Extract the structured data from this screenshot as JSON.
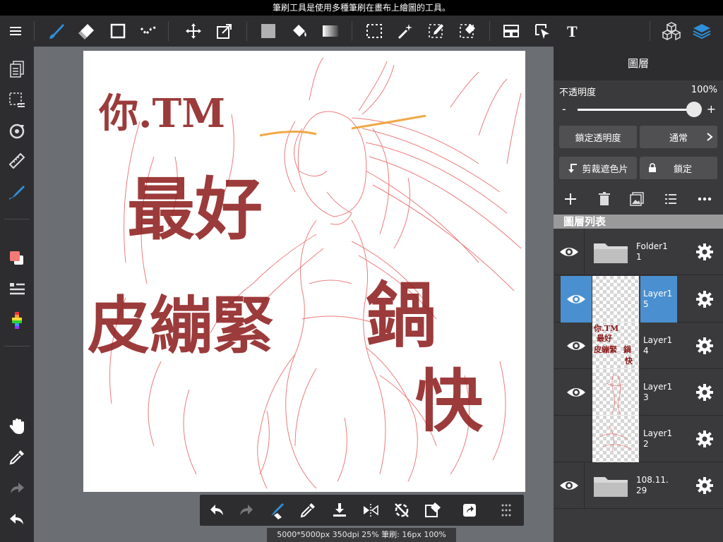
{
  "message": "筆刷工具是使用多種筆刷在畫布上繪圖的工具。",
  "status": "5000*5000px 350dpi 25% 筆刷: 16px 100%",
  "colors": {
    "accent": "#2f8fd8",
    "bg": "#6b6e73",
    "bar": "#2d2d2f",
    "panel": "#3a3a3c",
    "primary_color": "#f47a78",
    "selected_layer": "#4a90d0"
  },
  "panel": {
    "title": "圖層",
    "opacity_label": "不透明度",
    "opacity_value": "100%",
    "opacity_fraction": 1.0,
    "minus": "-",
    "plus": "+",
    "lock_opacity": "鎖定透明度",
    "blend_mode": "通常",
    "clipping": "剪裁遮色片",
    "lock": "鎖定",
    "list_header": "圖層列表"
  },
  "layers": [
    {
      "name": "Folder11",
      "type": "folder",
      "visible": true,
      "selected": false
    },
    {
      "name": "Layer15",
      "type": "layer",
      "visible": true,
      "selected": true
    },
    {
      "name": "Layer14",
      "type": "layer",
      "visible": true,
      "selected": false
    },
    {
      "name": "Layer13",
      "type": "layer",
      "visible": true,
      "selected": false
    },
    {
      "name": "Layer12",
      "type": "layer",
      "visible": false,
      "selected": false
    },
    {
      "name": "108.11.29",
      "type": "folder",
      "visible": true,
      "selected": false
    }
  ],
  "toolbar": {
    "icons": [
      "menu-icon",
      "brush-icon",
      "eraser-icon",
      "rectangle-icon",
      "dotted-line-icon",
      "move-icon",
      "transform-icon",
      "fill-color-icon",
      "bucket-icon",
      "gradient-icon",
      "select-rect-icon",
      "magic-wand-icon",
      "select-pen-icon",
      "select-eraser-icon",
      "frame-icon",
      "operation-icon",
      "text-icon",
      "material-icon",
      "layers-icon"
    ]
  },
  "canvas": {
    "text_lines": [
      "你.TM",
      "最好",
      "皮繃緊",
      "鍋",
      "鍋",
      "快"
    ]
  }
}
